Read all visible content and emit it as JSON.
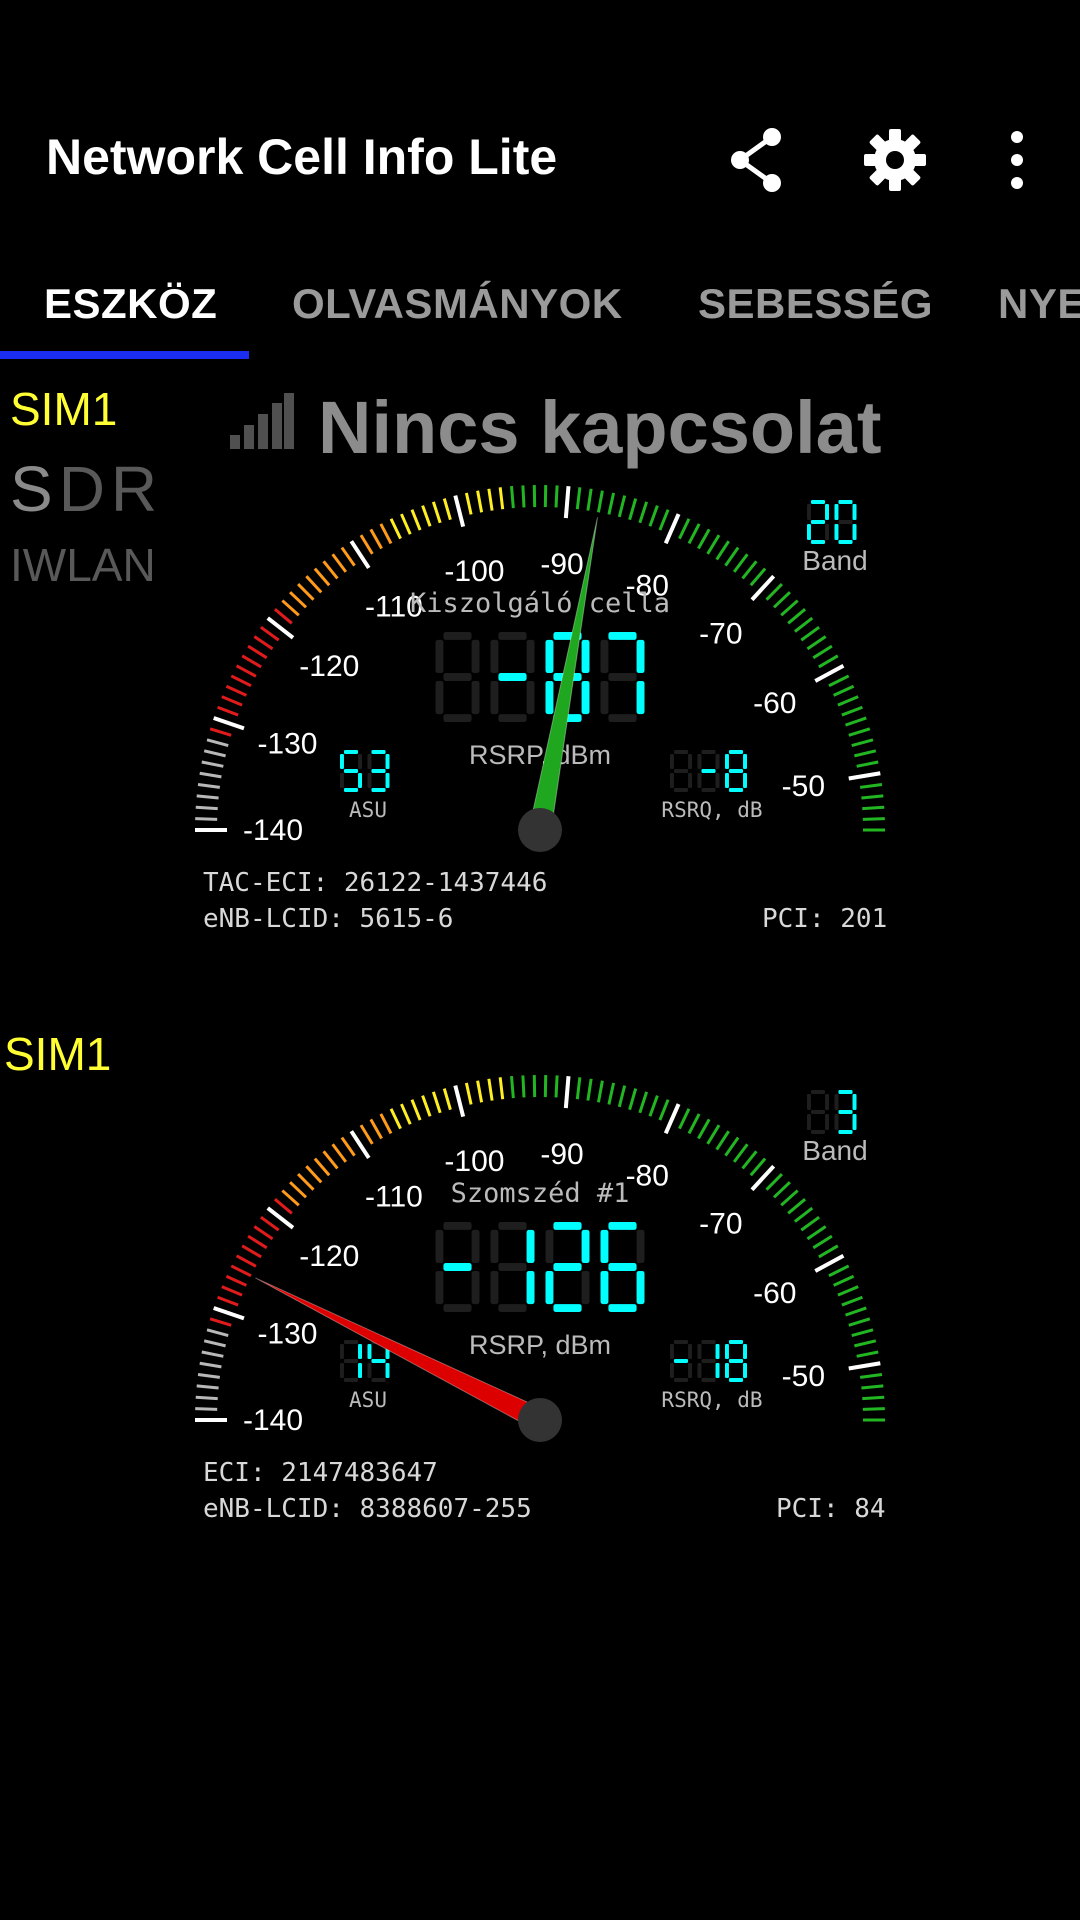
{
  "app": {
    "title": "Network Cell Info Lite"
  },
  "actions": [
    {
      "name": "share-icon"
    },
    {
      "name": "gear-icon"
    },
    {
      "name": "more-vert-icon"
    }
  ],
  "tabs": [
    {
      "label": "ESZKÖZ",
      "active": true
    },
    {
      "label": "OLVASMÁNYOK",
      "active": false
    },
    {
      "label": "SEBESSÉG",
      "active": false
    },
    {
      "label": "NYE",
      "active": false
    }
  ],
  "sim_panel": {
    "sim": "SIM1",
    "s": "S",
    "d": "D",
    "r": "R",
    "iwlan": "IWLAN",
    "status_text": "Nincs kapcsolat"
  },
  "colors": {
    "accent": "#1a2df0",
    "sim": "#ffff33",
    "lcd": "#00ffff",
    "needle_serving": "#1fa81f",
    "needle_neighbor": "#dd0000"
  },
  "gauge_scale": [
    "-140",
    "-130",
    "-120",
    "-110",
    "-100",
    "-90",
    "-80",
    "-70",
    "-60",
    "-50"
  ],
  "gauges": [
    {
      "id": "serving",
      "sim": "SIM1",
      "title": "Kiszolgáló cella",
      "rsrp": "-87",
      "rsrp_label": "RSRP, dBm",
      "needle_value": -87,
      "band": "20",
      "band_label": "Band",
      "asu": "53",
      "asu_label": "ASU",
      "rsrq": "-8",
      "rsrq_label": "RSRQ, dB",
      "needle_color": "#1fa81f",
      "line1_left": "TAC-ECI: 26122-1437446",
      "line2_left": "eNB-LCID: 5615-6",
      "line2_right": "PCI: 201"
    },
    {
      "id": "neighbor",
      "sim": "SIM1",
      "title": "Szomszéd #1",
      "rsrp": "-126",
      "rsrp_label": "RSRP, dBm",
      "needle_value": -126,
      "band": "3",
      "band_label": "Band",
      "asu": "14",
      "asu_label": "ASU",
      "rsrq": "-18",
      "rsrq_label": "RSRQ, dB",
      "needle_color": "#dd0000",
      "line1_left": "ECI: 2147483647",
      "line2_left": "eNB-LCID: 8388607-255",
      "line2_right": "PCI: 84"
    }
  ]
}
